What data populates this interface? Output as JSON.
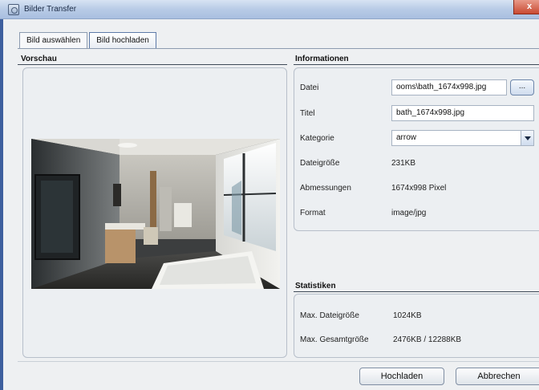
{
  "window": {
    "title": "Bilder Transfer",
    "close_label": "x"
  },
  "tabs": [
    {
      "label": "Bild auswählen",
      "active": false
    },
    {
      "label": "Bild hochladen",
      "active": true
    }
  ],
  "preview": {
    "title": "Vorschau"
  },
  "info": {
    "title": "Informationen",
    "datei_label": "Datei",
    "datei_value": "ooms\\bath_1674x998.jpg",
    "browse_label": "...",
    "titel_label": "Titel",
    "titel_value": "bath_1674x998.jpg",
    "kategorie_label": "Kategorie",
    "kategorie_value": "arrow",
    "groesse_label": "Dateigröße",
    "groesse_value": "231KB",
    "abmessungen_label": "Abmessungen",
    "abmessungen_value": "1674x998 Pixel",
    "format_label": "Format",
    "format_value": "image/jpg"
  },
  "stats": {
    "title": "Statistiken",
    "max_datei_label": "Max. Dateigröße",
    "max_datei_value": "1024KB",
    "max_gesamt_label": "Max. Gesamtgröße",
    "max_gesamt_value": "2476KB / 12288KB"
  },
  "buttons": {
    "upload": "Hochladen",
    "cancel": "Abbrechen"
  },
  "colors": {
    "titlebar": "#b8cbe6",
    "accent": "#3d5f9e",
    "close": "#c94a32"
  }
}
